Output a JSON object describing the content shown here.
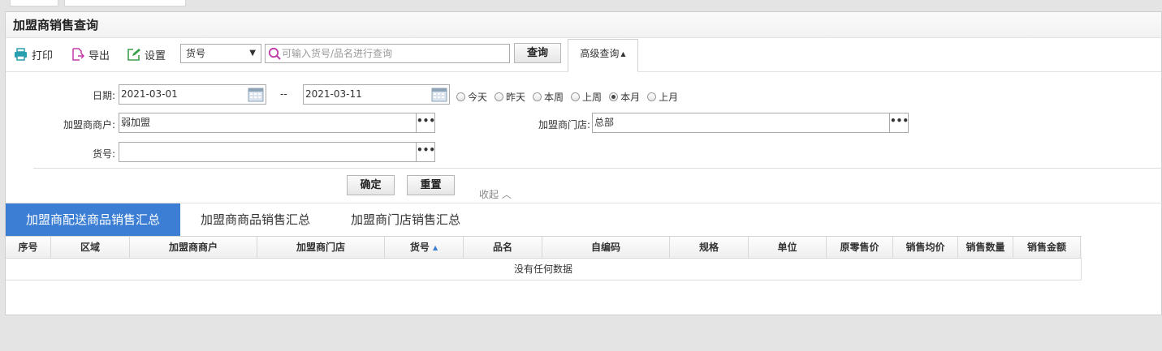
{
  "page": {
    "title": "加盟商销售查询"
  },
  "toolbar": {
    "print_label": "打印",
    "export_label": "导出",
    "settings_label": "设置",
    "field_select_value": "货号",
    "search_placeholder": "可输入货号/品名进行查询",
    "query_label": "查询",
    "advanced_label": "高级查询",
    "advanced_arrow": "▲"
  },
  "form": {
    "date_label": "日期:",
    "date_from": "2021-03-01",
    "date_sep": "--",
    "date_to": "2021-03-11",
    "periods": [
      {
        "label": "今天",
        "checked": false
      },
      {
        "label": "昨天",
        "checked": false
      },
      {
        "label": "本周",
        "checked": false
      },
      {
        "label": "上周",
        "checked": false
      },
      {
        "label": "本月",
        "checked": true
      },
      {
        "label": "上月",
        "checked": false
      }
    ],
    "merchant_label": "加盟商商户:",
    "merchant_value": "弱加盟",
    "store_label": "加盟商门店:",
    "store_value": "总部",
    "sku_label": "货号:",
    "sku_value": "",
    "more_glyph": "•••",
    "confirm_label": "确定",
    "reset_label": "重置",
    "collapse_label": "收起 ︿"
  },
  "tabs": [
    {
      "label": "加盟商配送商品销售汇总",
      "active": true
    },
    {
      "label": "加盟商商品销售汇总",
      "active": false
    },
    {
      "label": "加盟商门店销售汇总",
      "active": false
    }
  ],
  "grid": {
    "columns": [
      "序号",
      "区域",
      "加盟商商户",
      "加盟商门店",
      "货号",
      "品名",
      "自编码",
      "规格",
      "单位",
      "原零售价",
      "销售均价",
      "销售数量",
      "销售金额"
    ],
    "sorted_column": "货号",
    "sort_glyph": "▲",
    "empty_text": "没有任何数据"
  },
  "colors": {
    "accent": "#3b7ed3",
    "print_icon": "#2a9fb0",
    "export_icon": "#c03aa8",
    "settings_icon": "#3aa04a"
  }
}
